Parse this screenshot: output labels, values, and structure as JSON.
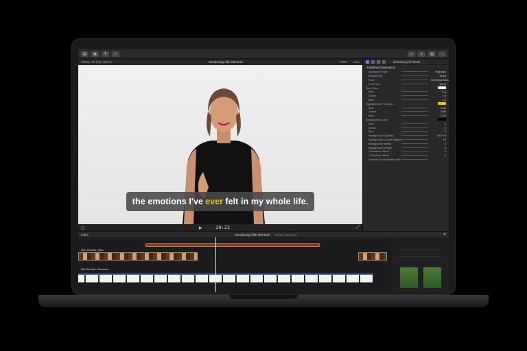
{
  "viewer": {
    "format": "1080p HD (24), Stereo",
    "title": "Introducing Allie Sherlock",
    "zoom": "100%",
    "view_label": "View",
    "timecode": "29:22"
  },
  "caption": {
    "before": "the emotions I've",
    "highlight": "ever",
    "after": "felt in my whole life."
  },
  "inspector": {
    "title": "Introducing Til Words",
    "section": "Published Parameters",
    "rows": [
      {
        "label": "Animation Style",
        "value": "Highlight"
      },
      {
        "label": "Animate By",
        "value": "Word"
      },
      {
        "label": "Font",
        "value": "Helvetica Neue"
      },
      {
        "label": "Font Size",
        "value": "100.0"
      },
      {
        "label": "Text Color",
        "value": ""
      },
      {
        "label": "Red",
        "value": "1.0"
      },
      {
        "label": "Green",
        "value": "1.0"
      },
      {
        "label": "Blue",
        "value": "1.0"
      },
      {
        "label": "Highlight and Fill Color",
        "value": ""
      },
      {
        "label": "Red",
        "value": "1.00"
      },
      {
        "label": "Green",
        "value": "0.86"
      },
      {
        "label": "Blue",
        "value": "0.28"
      },
      {
        "label": "Background Color",
        "value": ""
      },
      {
        "label": "Red",
        "value": "0"
      },
      {
        "label": "Green",
        "value": "0"
      },
      {
        "label": "Blue",
        "value": "0"
      },
      {
        "label": "Background Opacity",
        "value": "80.0 %"
      },
      {
        "label": "Background Corner Radius",
        "value": "10"
      },
      {
        "label": "Background Width",
        "value": "0"
      },
      {
        "label": "Background Height",
        "value": "0"
      },
      {
        "label": "X Position Offset",
        "value": "0"
      },
      {
        "label": "Y Position Offset",
        "value": "0"
      },
      {
        "label": "Vertical Social Media Safe",
        "value": ""
      }
    ],
    "colors": {
      "text": "#ffffff",
      "highlight": "#f2c400",
      "background": "#000000"
    }
  },
  "timeline": {
    "title": "Introducing Allie Sherlock",
    "range": "08:22 / 51:16:12",
    "index_label": "Index",
    "video_track": "Allie_Sherlock_Video",
    "audio_track": "Allie Sherlock - Broadcast"
  }
}
